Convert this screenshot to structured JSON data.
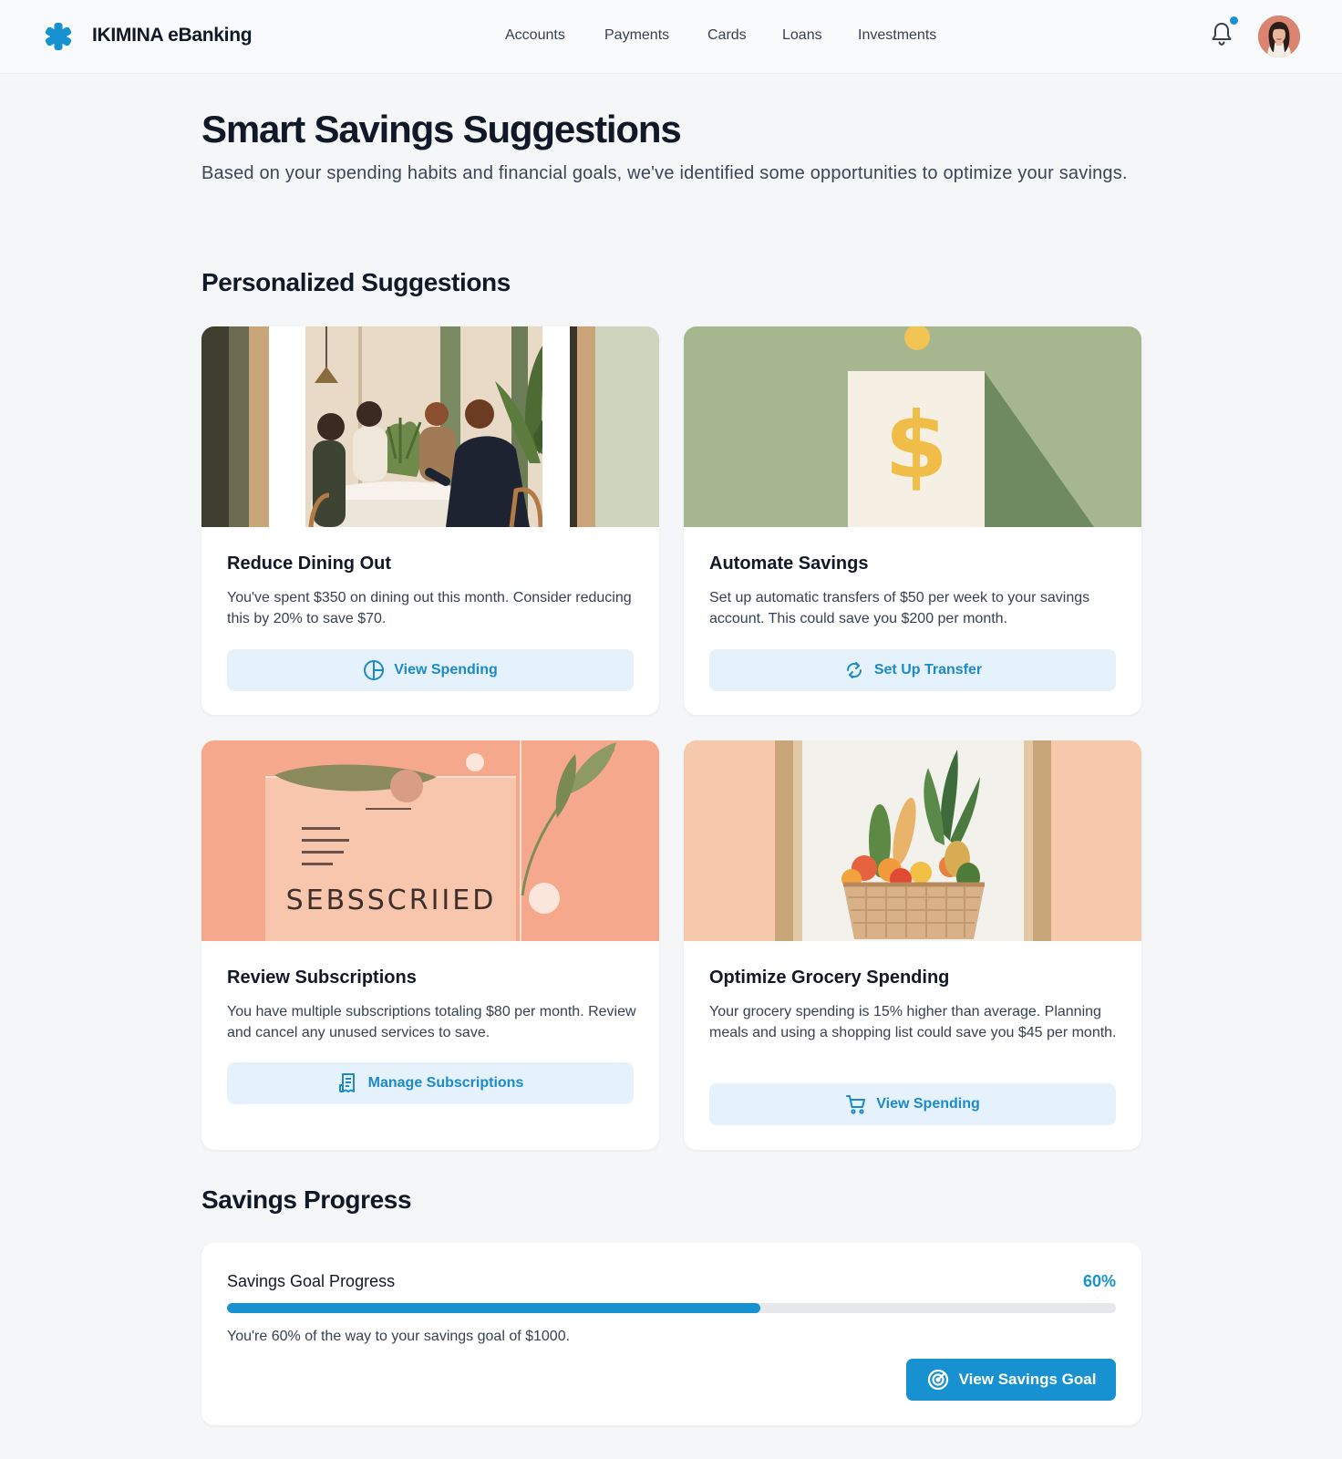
{
  "header": {
    "brand": "IKIMINA eBanking",
    "logo_icon": "asterisk-logo-icon",
    "nav": [
      "Accounts",
      "Payments",
      "Cards",
      "Loans",
      "Investments"
    ],
    "notification_icon": "bell-icon",
    "accent_color": "#1891d1"
  },
  "main": {
    "title": "Smart Savings Suggestions",
    "subtitle": "Based on your spending habits and financial goals, we've identified some opportunities to optimize your savings."
  },
  "suggestions": {
    "heading": "Personalized Suggestions",
    "cards": [
      {
        "title": "Reduce Dining Out",
        "text": "You've spent $350 on dining out this month. Consider reducing this by 20% to save $70.",
        "button": "View Spending",
        "button_icon": "pie-chart-icon",
        "image": "dining-illustration"
      },
      {
        "title": "Automate Savings",
        "text": "Set up automatic transfers of $50 per week to your savings account. This could save you $200 per month.",
        "button": "Set Up Transfer",
        "button_icon": "refresh-icon",
        "image": "dollar-card-illustration"
      },
      {
        "title": "Review Subscriptions",
        "text": "You have multiple subscriptions totaling $80 per month. Review and cancel any unused services to save.",
        "button": "Manage Subscriptions",
        "button_icon": "receipt-icon",
        "image": "subscriptions-illustration",
        "image_text": "SEBSSCRIIED"
      },
      {
        "title": "Optimize Grocery Spending",
        "text": "Your grocery spending is 15% higher than average. Planning meals and using a shopping list could save you $45 per month.",
        "button": "View Spending",
        "button_icon": "shopping-cart-icon",
        "image": "grocery-basket-illustration"
      }
    ]
  },
  "progress": {
    "heading": "Savings Progress",
    "label": "Savings Goal Progress",
    "percent_text": "60%",
    "percent": 60,
    "note": "You're 60% of the way to your savings goal of $1000.",
    "button": "View Savings Goal",
    "button_icon": "target-icon"
  }
}
